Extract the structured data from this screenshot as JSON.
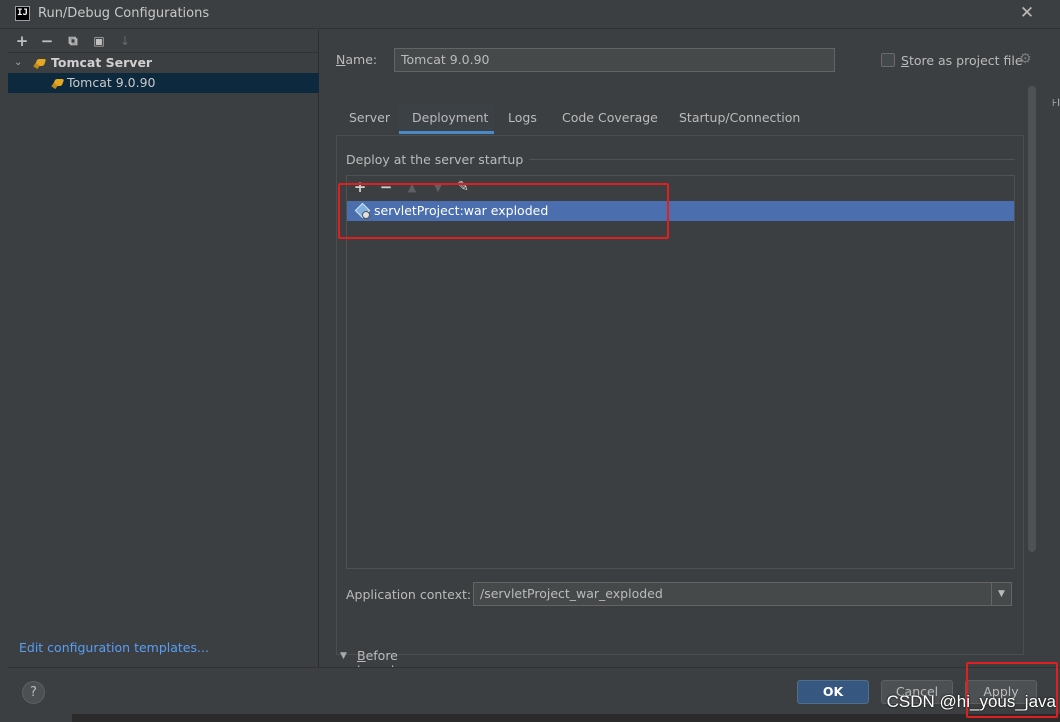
{
  "window": {
    "app_icon": "IJ",
    "title": "Run/Debug Configurations",
    "close_glyph": "✕"
  },
  "left_toolbar": {
    "add": "+",
    "remove": "−",
    "copy": "⧉",
    "folder": "▣",
    "sort": "↓"
  },
  "tree": {
    "category": "Tomcat Server",
    "item": "Tomcat 9.0.90"
  },
  "edit_templates": "Edit configuration templates...",
  "name": {
    "label_underlined": "N",
    "label_rest": "ame:",
    "value": "Tomcat 9.0.90"
  },
  "store": {
    "label_underlined": "S",
    "label_rest": "tore as project file",
    "checked": false
  },
  "tabs": [
    "Server",
    "Deployment",
    "Logs",
    "Code Coverage",
    "Startup/Connection"
  ],
  "active_tab": "Deployment",
  "deploy": {
    "group_title": "Deploy at the server startup",
    "toolbar": {
      "add": "+",
      "remove": "−",
      "up": "▲",
      "down": "▼",
      "edit": "✎"
    },
    "items": [
      "servletProject:war exploded"
    ]
  },
  "app_context": {
    "label": "Application context:",
    "value": "/servletProject_war_exploded",
    "arrow": "▼"
  },
  "before_launch": {
    "arrow": "▼",
    "label_underlined": "B",
    "label_rest": "efore launch"
  },
  "buttons": {
    "help": "?",
    "ok": "OK",
    "cancel": "Cancel",
    "apply": "Apply"
  },
  "watermark": "CSDN @hi_yous_java",
  "edge_text": "⊦l",
  "colors": {
    "background": "#3c3f41",
    "selection": "#4b6eaf",
    "tree_selection": "#0d293e",
    "link": "#589df6",
    "primary_button": "#365880",
    "annotation": "#e02020",
    "tab_underline": "#4a88c7"
  }
}
